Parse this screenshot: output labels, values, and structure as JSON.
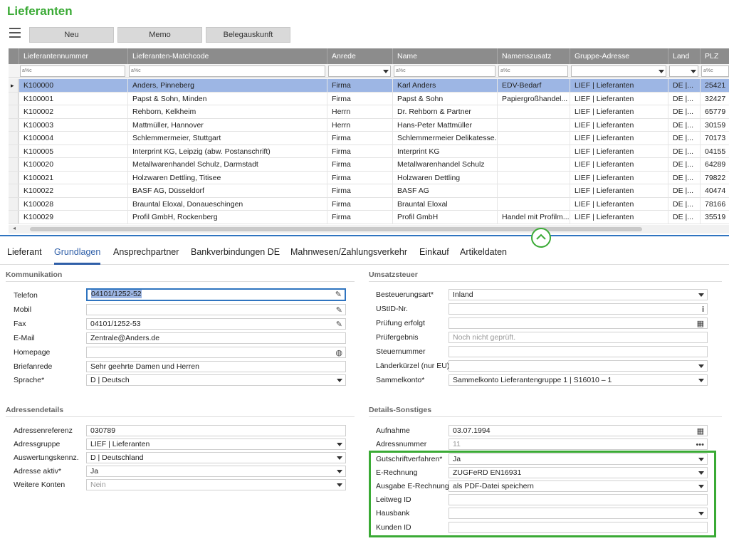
{
  "app": {
    "title": "Lieferanten"
  },
  "toolbar": {
    "buttons": [
      "Neu",
      "Memo",
      "Belegauskunft"
    ]
  },
  "grid": {
    "columns": [
      "Lieferantennummer",
      "Lieferanten-Matchcode",
      "Anrede",
      "Name",
      "Namenszusatz",
      "Gruppe-Adresse",
      "Land",
      "PLZ"
    ],
    "filter_placeholder": "a%c",
    "rows": [
      [
        "K100000",
        "Anders, Pinneberg",
        "Firma",
        "Karl Anders",
        "EDV-Bedarf",
        "LIEF | Lieferanten",
        "DE |...",
        "25421"
      ],
      [
        "K100001",
        "Papst & Sohn, Minden",
        "Firma",
        "Papst & Sohn",
        "Papiergroßhandel...",
        "LIEF | Lieferanten",
        "DE |...",
        "32427"
      ],
      [
        "K100002",
        "Rehborn, Kelkheim",
        "Herrn",
        "Dr. Rehborn & Partner",
        "",
        "LIEF | Lieferanten",
        "DE |...",
        "65779"
      ],
      [
        "K100003",
        "Mattmüller, Hannover",
        "Herrn",
        "Hans-Peter Mattmüller",
        "",
        "LIEF | Lieferanten",
        "DE |...",
        "30159"
      ],
      [
        "K100004",
        "Schlemmermeier, Stuttgart",
        "Firma",
        "Schlemmermeier Delikatesse...",
        "",
        "LIEF | Lieferanten",
        "DE |...",
        "70173"
      ],
      [
        "K100005",
        "Interprint KG, Leipzig (abw. Postanschrift)",
        "Firma",
        "Interprint KG",
        "",
        "LIEF | Lieferanten",
        "DE |...",
        "04155"
      ],
      [
        "K100020",
        "Metallwarenhandel Schulz, Darmstadt",
        "Firma",
        "Metallwarenhandel Schulz",
        "",
        "LIEF | Lieferanten",
        "DE |...",
        "64289"
      ],
      [
        "K100021",
        "Holzwaren Dettling, Titisee",
        "Firma",
        "Holzwaren Dettling",
        "",
        "LIEF | Lieferanten",
        "DE |...",
        "79822"
      ],
      [
        "K100022",
        "BASF AG, Düsseldorf",
        "Firma",
        "BASF AG",
        "",
        "LIEF | Lieferanten",
        "DE |...",
        "40474"
      ],
      [
        "K100028",
        "Brauntal Eloxal, Donaueschingen",
        "Firma",
        "Brauntal Eloxal",
        "",
        "LIEF | Lieferanten",
        "DE |...",
        "78166"
      ],
      [
        "K100029",
        "Profil GmbH, Rockenberg",
        "Firma",
        "Profil GmbH",
        "Handel mit Profilm...",
        "LIEF | Lieferanten",
        "DE |...",
        "35519"
      ]
    ]
  },
  "tabs": [
    "Lieferant",
    "Grundlagen",
    "Ansprechpartner",
    "Bankverbindungen DE",
    "Mahnwesen/Zahlungsverkehr",
    "Einkauf",
    "Artikeldaten"
  ],
  "kommunikation": {
    "title": "Kommunikation",
    "fields": [
      {
        "label": "Telefon",
        "value": "04101/1252-52"
      },
      {
        "label": "Mobil",
        "value": ""
      },
      {
        "label": "Fax",
        "value": "04101/1252-53"
      },
      {
        "label": "E-Mail",
        "value": "Zentrale@Anders.de"
      },
      {
        "label": "Homepage",
        "value": ""
      },
      {
        "label": "Briefanrede",
        "value": "Sehr geehrte Damen und Herren"
      },
      {
        "label": "Sprache*",
        "value": "D  |  Deutsch"
      }
    ]
  },
  "adressendetails": {
    "title": "Adressendetails",
    "fields": [
      {
        "label": "Adressenreferenz",
        "value": "030789"
      },
      {
        "label": "Adressgruppe",
        "value": "LIEF  |  Lieferanten"
      },
      {
        "label": "Auswertungskennz.",
        "value": "D  |  Deutschland"
      },
      {
        "label": "Adresse aktiv*",
        "value": "Ja"
      },
      {
        "label": "Weitere Konten",
        "value": "Nein"
      }
    ]
  },
  "umsatzsteuer": {
    "title": "Umsatzsteuer",
    "fields": [
      {
        "label": "Besteuerungsart*",
        "value": "Inland"
      },
      {
        "label": "UStID-Nr.",
        "value": ""
      },
      {
        "label": "Prüfung erfolgt",
        "value": ""
      },
      {
        "label": "Prüfergebnis",
        "value": "Noch nicht geprüft."
      },
      {
        "label": "Steuernummer",
        "value": ""
      },
      {
        "label": "Länderkürzel (nur EU)",
        "value": ""
      },
      {
        "label": "Sammelkonto*",
        "value": "Sammelkonto Lieferantengruppe 1  |  S16010  –  1"
      }
    ]
  },
  "sonstiges": {
    "title": "Details-Sonstiges",
    "fields": [
      {
        "label": "Aufnahme",
        "value": "03.07.1994"
      },
      {
        "label": "Adressnummer",
        "value": "11"
      },
      {
        "label": "Gutschriftverfahren*",
        "value": "Ja"
      },
      {
        "label": "E-Rechnung",
        "value": "ZUGFeRD EN16931"
      },
      {
        "label": "Ausgabe E-Rechnung",
        "value": "als PDF-Datei speichern"
      },
      {
        "label": "Leitweg ID",
        "value": ""
      },
      {
        "label": "Hausbank",
        "value": ""
      },
      {
        "label": "Kunden ID",
        "value": ""
      }
    ]
  },
  "colors": {
    "accent_green": "#3aaa35",
    "selection": "#9db6e4",
    "tab_active": "#2f5fa8"
  }
}
